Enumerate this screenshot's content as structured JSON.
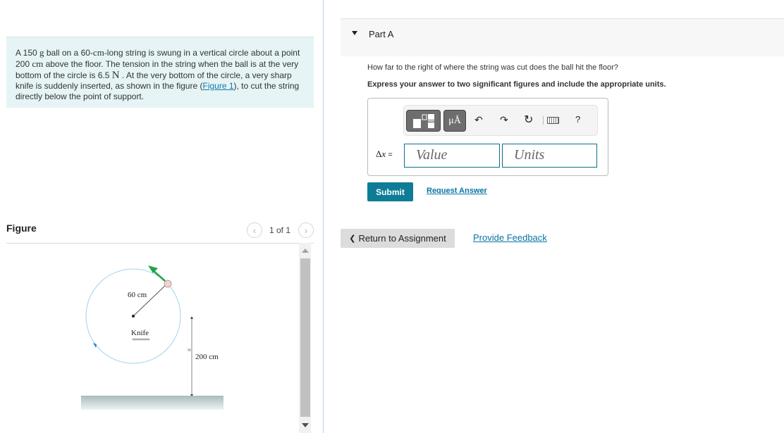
{
  "problem": {
    "text_1": "A 150 ",
    "unit_g": "g",
    "text_2": " ball on a 60-",
    "unit_cm_1": "cm",
    "text_3": "-long string is swung in a vertical circle about a point 200 ",
    "unit_cm_2": "cm",
    "text_4": " above the floor. The tension in the string when the ball is at the very bottom of the circle is 6.5 ",
    "unit_N": "N",
    "text_5": " . At the very bottom of the circle, a very sharp knife is suddenly inserted, as shown in the figure (",
    "figure_link": "Figure 1",
    "text_6": "), to cut the string directly below the point of support."
  },
  "figure": {
    "title": "Figure",
    "pager_text": "1 of 1",
    "prev_icon": "chevron-left-icon",
    "next_icon": "chevron-right-icon",
    "labels": {
      "radius": "60 cm",
      "knife": "Knife",
      "height": "200 cm",
      "break_mark": "≈"
    },
    "colors": {
      "circle": "#9fd3ee",
      "velocity_arrow": "#22a447",
      "ball": "#f0d6cf",
      "direction_marker": "#2b7fd4",
      "floor": "#b8c9c9"
    }
  },
  "part": {
    "title": "Part A",
    "question": "How far to the right of where the string was cut does the ball hit the floor?",
    "instruction": "Express your answer to two significant figures and include the appropriate units.",
    "toolbar": {
      "templates_icon": "templates-icon",
      "units_label": "μÅ",
      "undo_glyph": "↶",
      "redo_glyph": "↷",
      "reset_glyph": "↻",
      "keyboard_icon": "keyboard-icon",
      "help_label": "?"
    },
    "variable_delta": "Δ",
    "variable_x": "x",
    "equals": " =",
    "value_placeholder": "Value",
    "units_placeholder": "Units",
    "submit_label": "Submit",
    "request_answer_label": "Request Answer"
  },
  "footer": {
    "return_label": "Return to Assignment",
    "return_icon": "❮",
    "feedback_label": "Provide Feedback"
  },
  "colors": {
    "accent": "#0e7c96",
    "link": "#0a73a6",
    "problem_bg": "#e6f4f5"
  }
}
